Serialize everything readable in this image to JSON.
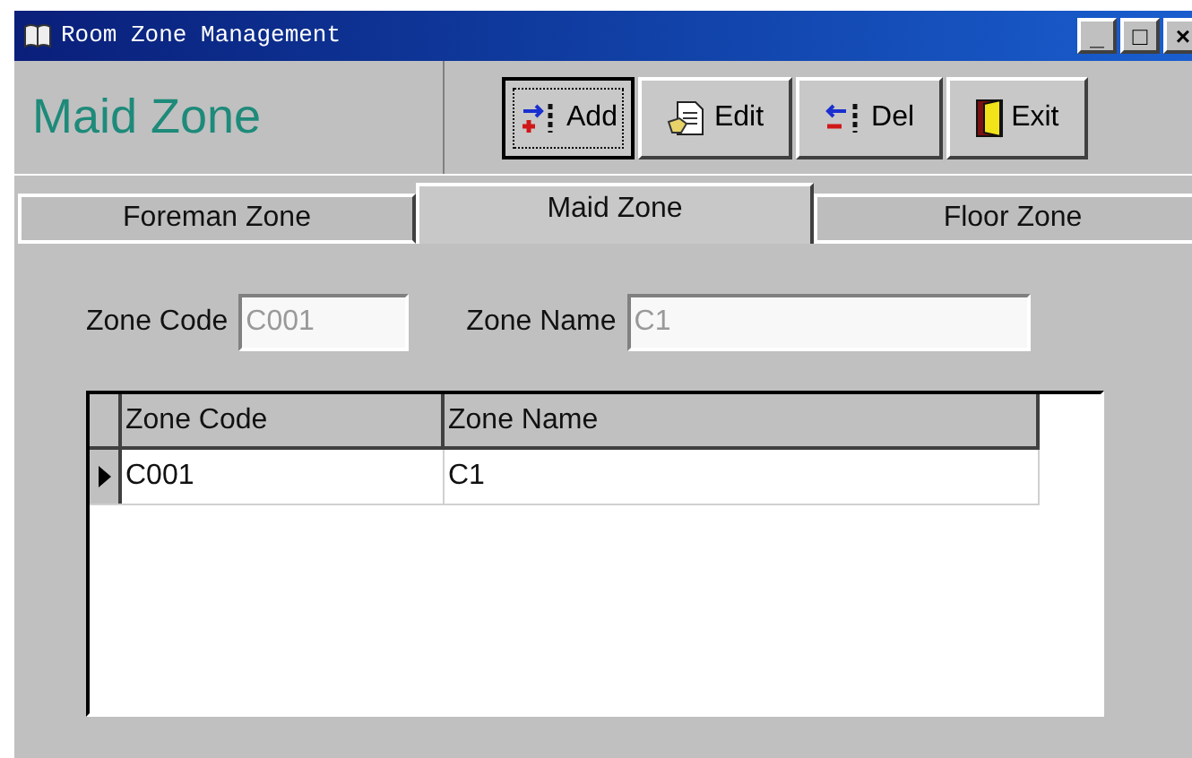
{
  "window": {
    "title": "Room Zone Management",
    "controls": [
      "_",
      "□",
      "×"
    ]
  },
  "header": {
    "title": "Maid Zone"
  },
  "toolbar": [
    {
      "label": "Add",
      "kind": "add",
      "focused": true
    },
    {
      "label": "Edit",
      "kind": "edit",
      "focused": false
    },
    {
      "label": "Del",
      "kind": "del",
      "focused": false
    },
    {
      "label": "Exit",
      "kind": "exit",
      "focused": false
    }
  ],
  "tabs": [
    {
      "label": "Foreman Zone",
      "selected": false
    },
    {
      "label": "Maid Zone",
      "selected": true
    },
    {
      "label": "Floor Zone",
      "selected": false
    }
  ],
  "form": {
    "zone_code": {
      "label": "Zone Code",
      "value": "C001"
    },
    "zone_name": {
      "label": "Zone Name",
      "value": "C1"
    }
  },
  "table": {
    "columns": [
      "Zone Code",
      "Zone Name"
    ],
    "rows": [
      {
        "cells": [
          "C001",
          "C1"
        ],
        "selected": true
      }
    ]
  }
}
